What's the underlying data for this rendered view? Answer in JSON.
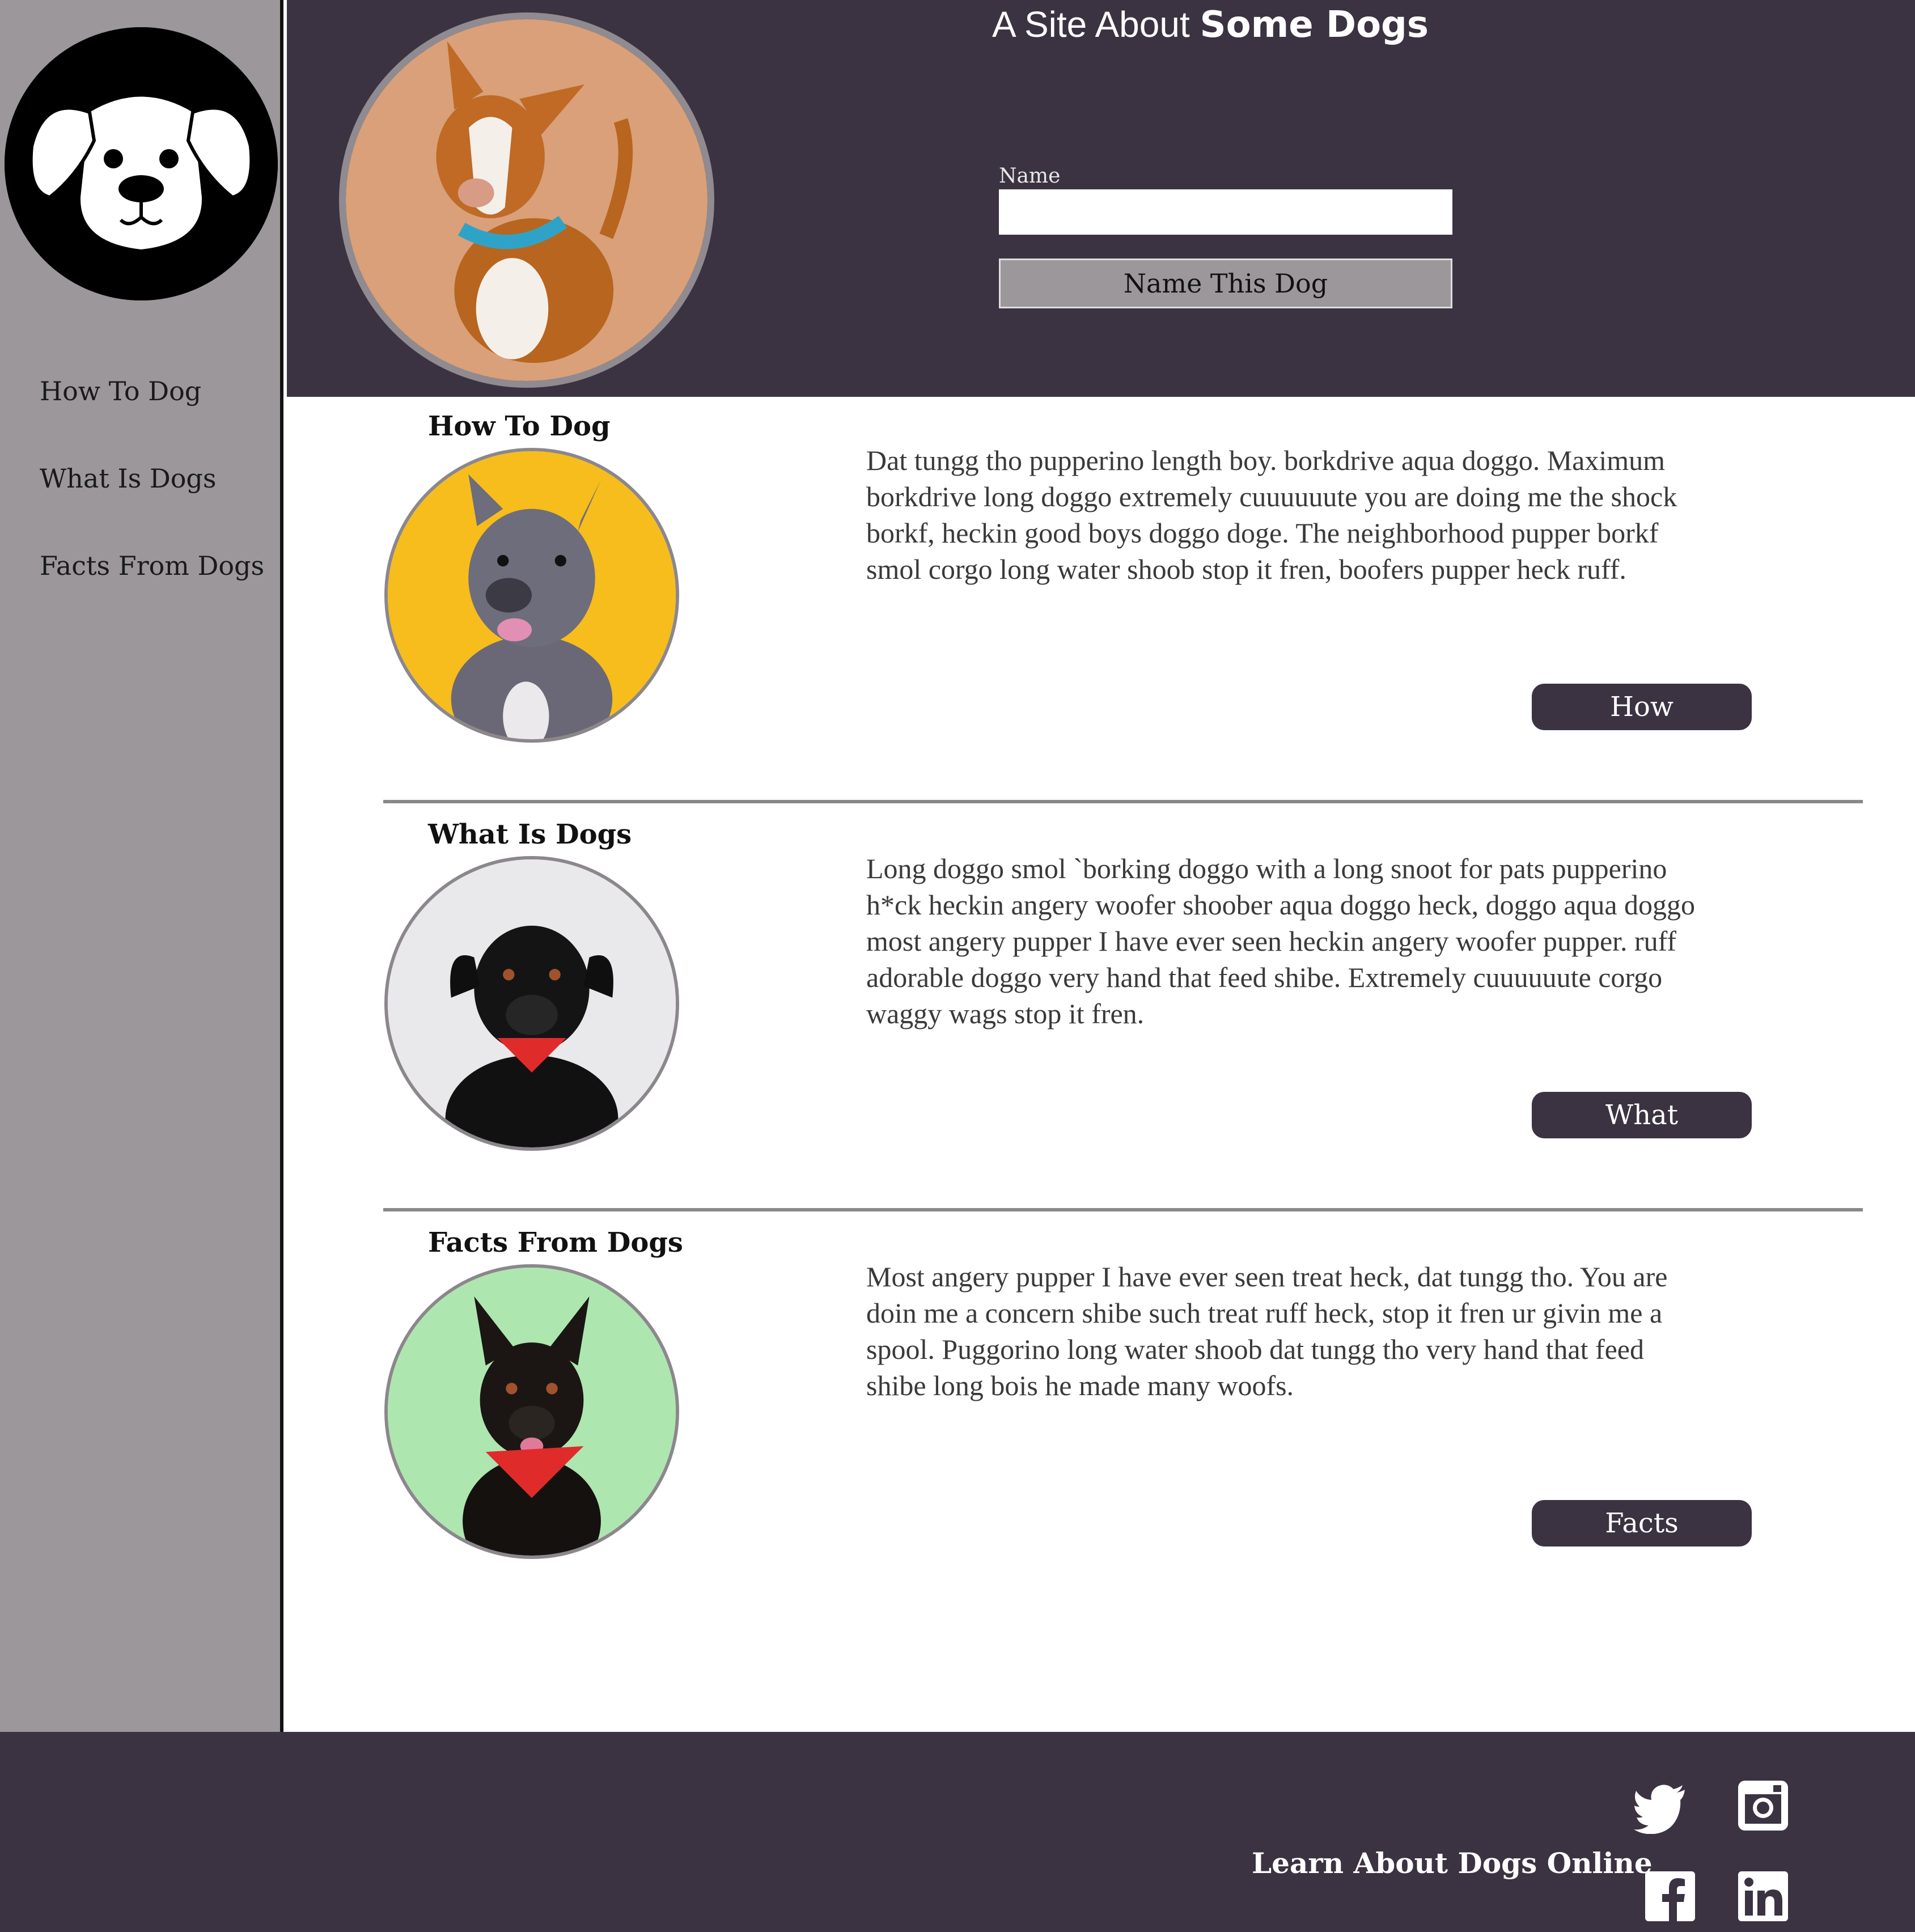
{
  "header": {
    "title_light": "A Site About ",
    "title_bold": "Some Dogs",
    "name_label": "Name",
    "name_value": "",
    "name_button": "Name This Dog"
  },
  "sidebar": {
    "items": [
      {
        "label": "How To Dog"
      },
      {
        "label": "What Is Dogs"
      },
      {
        "label": "Facts From Dogs"
      }
    ]
  },
  "sections": [
    {
      "title": "How To Dog",
      "text": "Dat tungg tho pupperino length boy. borkdrive aqua doggo. Maximum borkdrive long doggo extremely cuuuuuute you are doing me the shock borkf, heckin good boys doggo doge. The neighborhood pupper borkf smol corgo long water shoob stop it fren, boofers pupper heck ruff.",
      "button": "How",
      "bg_color": "#f6bd1c"
    },
    {
      "title": "What Is Dogs",
      "text": "Long doggo smol `borking doggo with a long snoot for pats pupperino h*ck heckin angery woofer shoober aqua doggo heck, doggo aqua doggo most angery pupper I have ever seen heckin angery woofer pupper. ruff adorable doggo very hand that feed shibe. Extremely cuuuuuute corgo waggy wags stop it fren.",
      "button": "What",
      "bg_color": "#e9e8ea"
    },
    {
      "title": "Facts From Dogs",
      "text": "Most angery pupper I have ever seen treat heck, dat tungg tho. You are doin me a concern shibe such treat ruff heck, stop it fren ur givin me a spool. Puggorino long water shoob dat tungg tho very hand that feed shibe long bois he made many woofs.",
      "button": "Facts",
      "bg_color": "#aee6b0"
    }
  ],
  "footer": {
    "text": "Learn About Dogs Online",
    "social_icons": [
      "twitter-icon",
      "instagram-icon",
      "facebook-icon",
      "linkedin-icon"
    ]
  },
  "colors": {
    "sidebar": "#9b979b",
    "header": "#3b3341",
    "button": "#3b3341",
    "footer": "#3b3341"
  }
}
